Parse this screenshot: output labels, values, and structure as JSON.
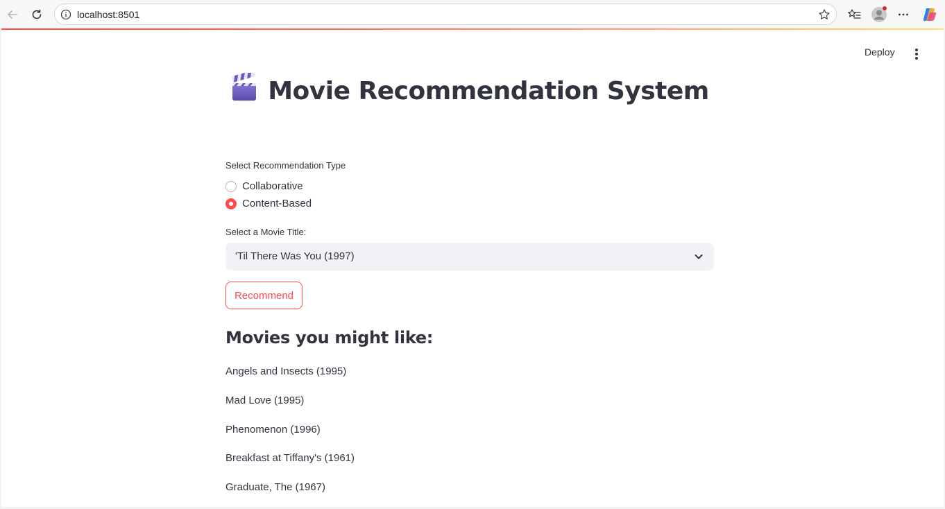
{
  "browser": {
    "url": "localhost:8501"
  },
  "header": {
    "deploy_label": "Deploy"
  },
  "app": {
    "title": "Movie Recommendation System",
    "title_icon": "clapper-board-icon",
    "recommendation_type": {
      "label": "Select Recommendation Type",
      "options": [
        "Collaborative",
        "Content-Based"
      ],
      "selected": "Content-Based"
    },
    "movie_select": {
      "label": "Select a Movie Title:",
      "value": "'Til There Was You (1997)"
    },
    "recommend_button": "Recommend",
    "results_heading": "Movies you might like:",
    "results": [
      "Angels and Insects (1995)",
      "Mad Love (1995)",
      "Phenomenon (1996)",
      "Breakfast at Tiffany's (1961)",
      "Graduate, The (1967)"
    ]
  },
  "colors": {
    "accent": "#ff4b4b",
    "text": "#31333f",
    "select_bg": "#f0f2f6"
  }
}
